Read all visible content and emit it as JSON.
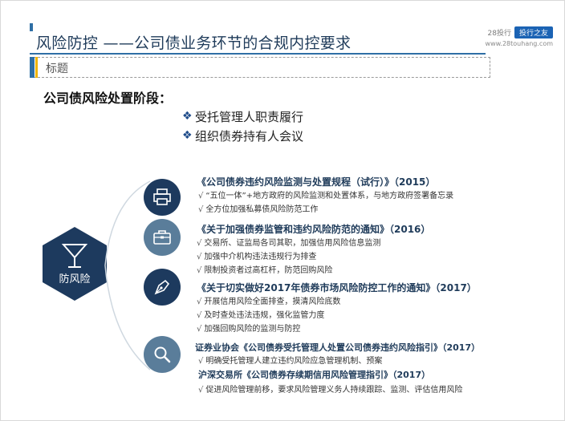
{
  "title": "风险防控 ——公司债业务环节的合规内控要求",
  "logo": {
    "brand": "28投行",
    "badge": "投行之友",
    "url": "www.28touhang.com"
  },
  "subheading": "标题",
  "stage_label": "公司债风险处置阶段：",
  "stage_bullets": [
    "受托管理人职责履行",
    "组织债券持有人会议"
  ],
  "center_label": "防风险",
  "tick_mark": "√",
  "bullet_mark": "❖",
  "regulations": [
    {
      "title": "《公司债券违约风险监测与处置规程（试行）》（2015）",
      "icon": "printer-icon",
      "items": [
        "“五位一体”+地方政府的风险监测和处置体系，与地方政府签署备忘录",
        "全方位加强私募债风险防范工作"
      ]
    },
    {
      "title": "《关于加强债券监管和违约风险防范的通知》（2016）",
      "icon": "briefcase-icon",
      "items": [
        "交易所、证监局各司其职，加强信用风险信息监测",
        "加强中介机构违法违规行为排查",
        "限制投资者过高杠杆，防范回购风险"
      ]
    },
    {
      "title": "《关于切实做好2017年债券市场风险防控工作的通知》（2017）",
      "icon": "pen-nib-icon",
      "items": [
        "开展信用风险全面排查，摸清风险底数",
        "及时查处违法违规，强化监管力度",
        "加强回购风险的监测与防控"
      ]
    },
    {
      "title": "证券业协会《公司债券受托管理人处置公司债券违约风险指引》（2017）",
      "icon": "magnifier-icon",
      "items": [
        "明确受托管理人建立违约风险应急管理机制、预案"
      ]
    },
    {
      "title": "沪深交易所《公司债券存续期信用风险管理指引》（2017）",
      "icon": "magnifier-icon",
      "items": [
        "促进风险管理前移，要求风险管理义务人持续跟踪、监测、评估信用风险"
      ]
    }
  ]
}
